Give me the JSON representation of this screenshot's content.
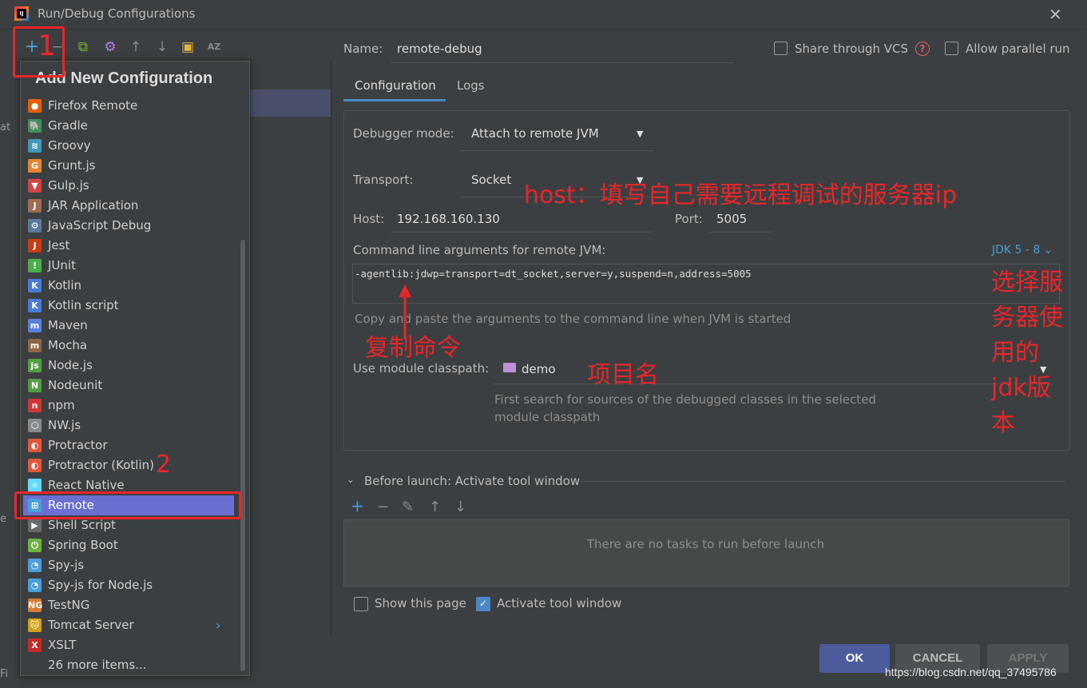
{
  "window": {
    "title": "Run/Debug Configurations",
    "close_label": "✕",
    "logo_text": "IJ"
  },
  "toolbar": {
    "add": "+",
    "remove": "−",
    "copy": "⧉",
    "edit": "⚙",
    "up": "↑",
    "down": "↓",
    "folder": "▣",
    "sort": "AZ"
  },
  "popup": {
    "title": "Add New Configuration",
    "items": [
      {
        "label": "Firefox Remote",
        "icon": "firefox-icon",
        "glyph": "●",
        "color": "#e66000"
      },
      {
        "label": "Gradle",
        "icon": "gradle-icon",
        "glyph": "🐘",
        "color": "#3f8f5a"
      },
      {
        "label": "Groovy",
        "icon": "groovy-icon",
        "glyph": "≋",
        "color": "#4298b8"
      },
      {
        "label": "Grunt.js",
        "icon": "grunt-icon",
        "glyph": "G",
        "color": "#e48632"
      },
      {
        "label": "Gulp.js",
        "icon": "gulp-icon",
        "glyph": "▼",
        "color": "#cf4647"
      },
      {
        "label": "JAR Application",
        "icon": "jar-icon",
        "glyph": "J",
        "color": "#a06a55"
      },
      {
        "label": "JavaScript Debug",
        "icon": "js-debug-icon",
        "glyph": "⚙",
        "color": "#5a7a9a"
      },
      {
        "label": "Jest",
        "icon": "jest-icon",
        "glyph": "J",
        "color": "#c63d14"
      },
      {
        "label": "JUnit",
        "icon": "junit-icon",
        "glyph": "!",
        "color": "#4cae4c"
      },
      {
        "label": "Kotlin",
        "icon": "kotlin-icon",
        "glyph": "K",
        "color": "#4a7bd8"
      },
      {
        "label": "Kotlin script",
        "icon": "kotlin-script-icon",
        "glyph": "K",
        "color": "#4a7bd8"
      },
      {
        "label": "Maven",
        "icon": "maven-icon",
        "glyph": "m",
        "color": "#5a80d8"
      },
      {
        "label": "Mocha",
        "icon": "mocha-icon",
        "glyph": "m",
        "color": "#8d6748"
      },
      {
        "label": "Node.js",
        "icon": "nodejs-icon",
        "glyph": "js",
        "color": "#539e43"
      },
      {
        "label": "Nodeunit",
        "icon": "nodeunit-icon",
        "glyph": "N",
        "color": "#539e43"
      },
      {
        "label": "npm",
        "icon": "npm-icon",
        "glyph": "n",
        "color": "#cb3837"
      },
      {
        "label": "NW.js",
        "icon": "nwjs-icon",
        "glyph": "⬡",
        "color": "#8a8a8a"
      },
      {
        "label": "Protractor",
        "icon": "protractor-icon",
        "glyph": "◐",
        "color": "#e0573e"
      },
      {
        "label": "Protractor (Kotlin)",
        "icon": "protractor-kotlin-icon",
        "glyph": "◐",
        "color": "#e0573e"
      },
      {
        "label": "React Native",
        "icon": "react-icon",
        "glyph": "⚛",
        "color": "#61dafb"
      },
      {
        "label": "Remote",
        "icon": "remote-icon",
        "glyph": "⊞",
        "color": "#4a9eda"
      },
      {
        "label": "Shell Script",
        "icon": "shell-icon",
        "glyph": "▶",
        "color": "#6a6a6a"
      },
      {
        "label": "Spring Boot",
        "icon": "spring-boot-icon",
        "glyph": "⏻",
        "color": "#6db33f"
      },
      {
        "label": "Spy-js",
        "icon": "spyjs-icon",
        "glyph": "◔",
        "color": "#4a9eda"
      },
      {
        "label": "Spy-js for Node.js",
        "icon": "spyjs-node-icon",
        "glyph": "◔",
        "color": "#4a9eda"
      },
      {
        "label": "TestNG",
        "icon": "testng-icon",
        "glyph": "NG",
        "color": "#d77b36"
      },
      {
        "label": "Tomcat Server",
        "icon": "tomcat-icon",
        "glyph": "🐱",
        "color": "#d4a017"
      },
      {
        "label": "XSLT",
        "icon": "xslt-icon",
        "glyph": "X",
        "color": "#c62828"
      },
      {
        "label": "26 more items...",
        "icon": "",
        "glyph": "",
        "color": ""
      }
    ],
    "selected_index": 20
  },
  "form": {
    "name_label": "Name:",
    "name_value": "remote-debug",
    "share_vcs_label": "Share through VCS",
    "help_label": "?",
    "allow_parallel_label": "Allow parallel run",
    "tabs": [
      "Configuration",
      "Logs"
    ],
    "debugger_mode_label": "Debugger mode:",
    "debugger_mode_value": "Attach to remote JVM",
    "transport_label": "Transport:",
    "transport_value": "Socket",
    "host_label": "Host:",
    "host_value": "192.168.160.130",
    "port_label": "Port:",
    "port_value": "5005",
    "cmd_label": "Command line arguments for remote JVM:",
    "jdk_link": "JDK 5 - 8 ⌄",
    "cmd_value": "-agentlib:jdwp=transport=dt_socket,server=y,suspend=n,address=5005",
    "cmd_hint": "Copy and paste the arguments to the command line when JVM is started",
    "module_label": "Use module classpath:",
    "module_value": "demo",
    "module_hint_1": "First search for sources of the debugged classes in the selected",
    "module_hint_2": "module classpath"
  },
  "before_launch": {
    "title": "Before launch: Activate tool window",
    "empty_text": "There are no tasks to run before launch",
    "add": "+",
    "remove": "−",
    "edit": "✎",
    "up": "↑",
    "down": "↓"
  },
  "footer": {
    "show_page_label": "Show this page",
    "activate_label": "Activate tool window",
    "activate_checked": true,
    "ok": "OK",
    "cancel": "CANCEL",
    "apply": "APPLY"
  },
  "annotations": {
    "step1": "1",
    "step2": "2",
    "host_note": "host：填写自己需要远程调试的服务器ip",
    "copy_note": "复制命令",
    "project_note": "项目名",
    "jdk_note_lines": [
      "选择服",
      "务器使",
      "用的",
      "jdk版",
      "本"
    ]
  },
  "watermark": "https://blog.csdn.net/qq_37495786",
  "edges": {
    "left_a": "at",
    "left_e": "e",
    "left_fi": "Fi"
  }
}
